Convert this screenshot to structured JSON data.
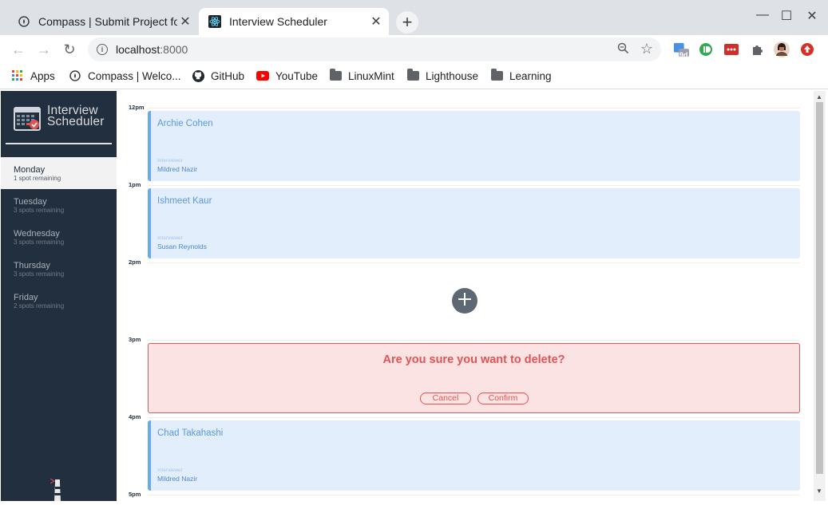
{
  "browser": {
    "tabs": [
      {
        "title": "Compass | Submit Project for",
        "active": false
      },
      {
        "title": "Interview Scheduler",
        "active": true
      }
    ],
    "new_tab": "+",
    "window": {
      "minimize": "—",
      "maximize": "☐",
      "close": "✕"
    },
    "url_host": "localhost",
    "url_port": ":8000",
    "extension_badge": "9d",
    "bookmarks": [
      {
        "label": "Apps",
        "icon": "apps-grid-icon"
      },
      {
        "label": "Compass | Welco...",
        "icon": "compass-icon"
      },
      {
        "label": "GitHub",
        "icon": "github-icon"
      },
      {
        "label": "YouTube",
        "icon": "youtube-icon"
      },
      {
        "label": "LinuxMint",
        "icon": "folder-icon"
      },
      {
        "label": "Lighthouse",
        "icon": "folder-icon"
      },
      {
        "label": "Learning",
        "icon": "folder-icon"
      }
    ]
  },
  "app": {
    "logo_line1": "Interview",
    "logo_line2": "Scheduler",
    "days": [
      {
        "name": "Monday",
        "spots": "1 spot remaining",
        "selected": true
      },
      {
        "name": "Tuesday",
        "spots": "3 spots remaining",
        "selected": false
      },
      {
        "name": "Wednesday",
        "spots": "3 spots remaining",
        "selected": false
      },
      {
        "name": "Thursday",
        "spots": "3 spots remaining",
        "selected": false
      },
      {
        "name": "Friday",
        "spots": "2 spots remaining",
        "selected": false
      }
    ],
    "times": [
      "12pm",
      "1pm",
      "2pm",
      "3pm",
      "4pm",
      "5pm"
    ],
    "appointments": [
      {
        "student": "Archie Cohen",
        "interviewer_label": "Interviewer",
        "interviewer": "Mildred Nazir"
      },
      {
        "student": "Ishmeet Kaur",
        "interviewer_label": "Interviewer",
        "interviewer": "Susan Reynolds"
      },
      {
        "student": "Chad Takahashi",
        "interviewer_label": "Interviewer",
        "interviewer": "Mildred Nazir"
      }
    ],
    "confirm": {
      "message": "Are you sure you want to delete?",
      "cancel": "Cancel",
      "confirm": "Confirm"
    },
    "colors": {
      "sidebar": "#222f3e",
      "appointment_bg": "#e2eefc",
      "appointment_accent": "#6aa9ef",
      "confirm_bg": "#fce3e3",
      "danger": "#e05454"
    }
  }
}
